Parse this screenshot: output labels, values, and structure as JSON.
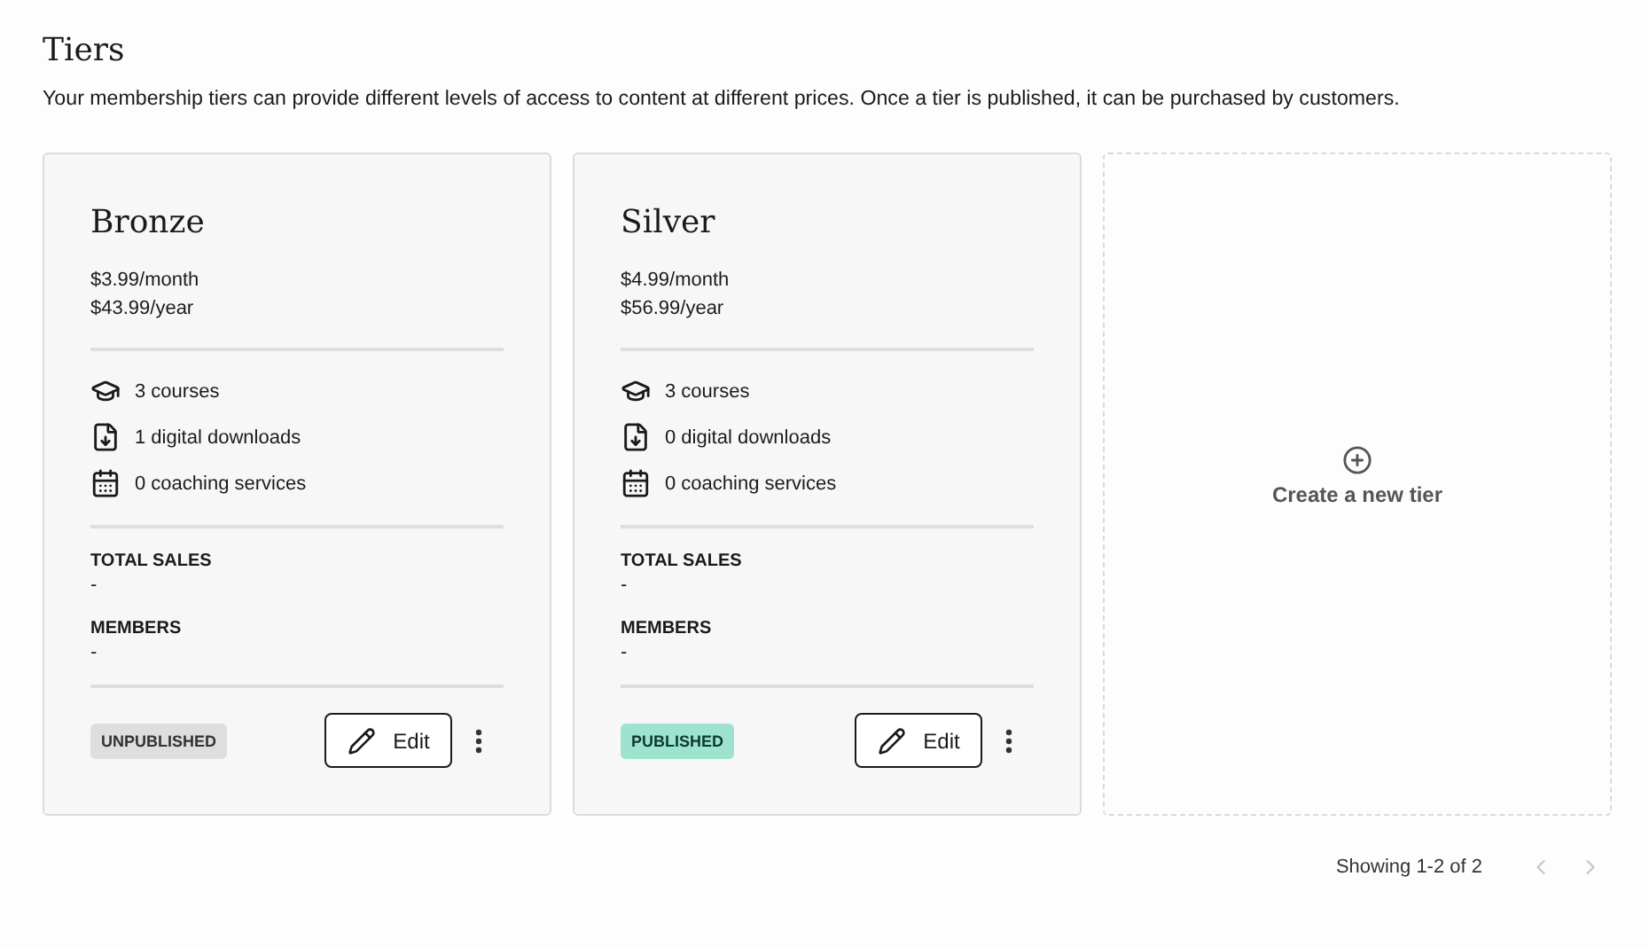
{
  "page": {
    "title": "Tiers",
    "description": "Your membership tiers can provide different levels of access to content at different prices. Once a tier is published, it can be purchased by customers."
  },
  "tiers": [
    {
      "name": "Bronze",
      "prices": [
        "$3.99/month",
        "$43.99/year"
      ],
      "features": [
        {
          "kind": "courses",
          "label": "3 courses"
        },
        {
          "kind": "downloads",
          "label": "1 digital downloads"
        },
        {
          "kind": "coaching",
          "label": "0 coaching services"
        }
      ],
      "stats": [
        {
          "label": "TOTAL SALES",
          "value": "-"
        },
        {
          "label": "MEMBERS",
          "value": "-"
        }
      ],
      "status": {
        "label": "UNPUBLISHED",
        "published": false
      },
      "edit_label": "Edit"
    },
    {
      "name": "Silver",
      "prices": [
        "$4.99/month",
        "$56.99/year"
      ],
      "features": [
        {
          "kind": "courses",
          "label": "3 courses"
        },
        {
          "kind": "downloads",
          "label": "0 digital downloads"
        },
        {
          "kind": "coaching",
          "label": "0 coaching services"
        }
      ],
      "stats": [
        {
          "label": "TOTAL SALES",
          "value": "-"
        },
        {
          "label": "MEMBERS",
          "value": "-"
        }
      ],
      "status": {
        "label": "PUBLISHED",
        "published": true
      },
      "edit_label": "Edit"
    }
  ],
  "create_tier": {
    "label": "Create a new tier"
  },
  "pagination": {
    "summary": "Showing 1-2 of 2",
    "prev_disabled": true,
    "next_disabled": true
  }
}
